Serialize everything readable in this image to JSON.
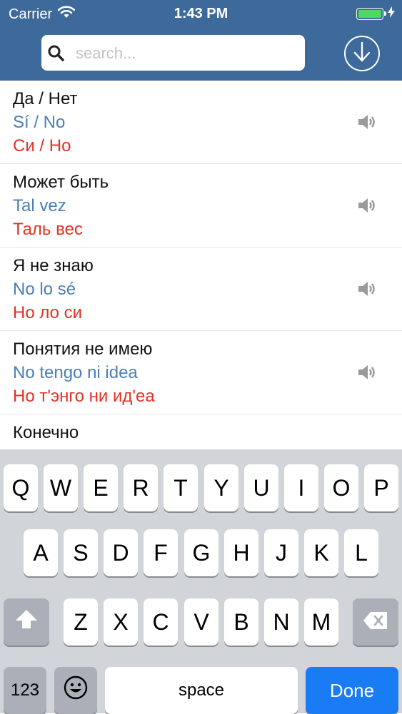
{
  "status_bar": {
    "carrier": "Carrier",
    "time": "1:43 PM",
    "battery_level": 1.0
  },
  "search": {
    "placeholder": "search...",
    "value": ""
  },
  "list": {
    "items": [
      {
        "russian": "Да / Нет",
        "spanish": "Sí / No",
        "transcription": "Си / Но"
      },
      {
        "russian": "Может быть",
        "spanish": "Tal vez",
        "transcription": "Таль вес"
      },
      {
        "russian": "Я не знаю",
        "spanish": "No lo sé",
        "transcription": "Но ло си"
      },
      {
        "russian": "Понятия не имею",
        "spanish": "No tengo ni idea",
        "transcription": "Но т'энго ни ид'еа"
      },
      {
        "russian": "Конечно",
        "spanish": "",
        "transcription": ""
      }
    ]
  },
  "keyboard": {
    "row1": [
      "Q",
      "W",
      "E",
      "R",
      "T",
      "Y",
      "U",
      "I",
      "O",
      "P"
    ],
    "row2": [
      "A",
      "S",
      "D",
      "F",
      "G",
      "H",
      "J",
      "K",
      "L"
    ],
    "row3": [
      "Z",
      "X",
      "C",
      "V",
      "B",
      "N",
      "M"
    ],
    "numbers_key": "123",
    "space_key": "space",
    "done_key": "Done"
  },
  "colors": {
    "header": "#3e6a9b",
    "spanish_text": "#4a7fb3",
    "transcription_text": "#e53024",
    "done_key": "#1a7cf5"
  },
  "icons": [
    "wifi-icon",
    "battery-icon",
    "charging-icon",
    "search-icon",
    "download-icon",
    "speaker-icon",
    "shift-icon",
    "backspace-icon",
    "emoji-icon"
  ]
}
